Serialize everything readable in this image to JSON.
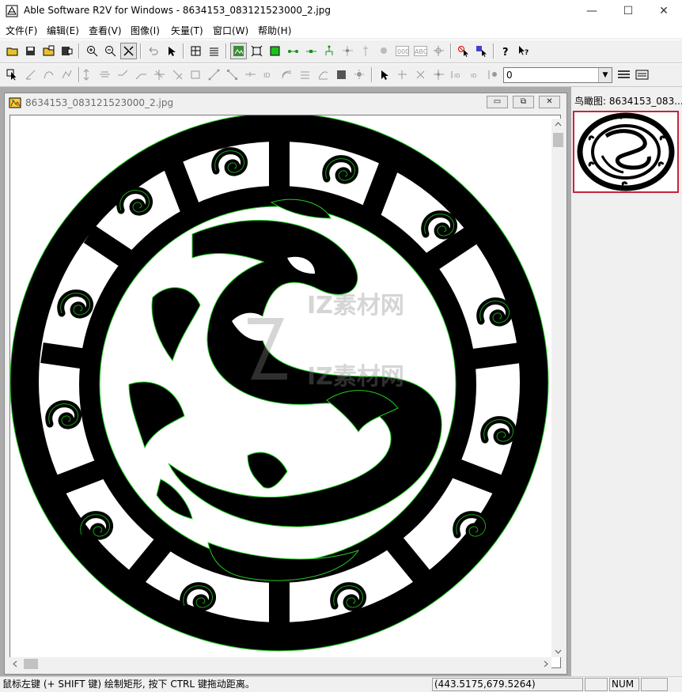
{
  "app": {
    "title": "Able Software R2V for Windows - 8634153_083121523000_2.jpg",
    "window_controls": {
      "minimize": "—",
      "maximize": "☐",
      "close": "✕"
    }
  },
  "menu": [
    "文件(F)",
    "编辑(E)",
    "查看(V)",
    "图像(I)",
    "矢量(T)",
    "窗口(W)",
    "帮助(H)"
  ],
  "toolbar1": {
    "buttons": [
      {
        "icon": "open-icon"
      },
      {
        "icon": "save-icon"
      },
      {
        "icon": "open-image-icon"
      },
      {
        "icon": "save-image-icon"
      },
      {
        "icon": "zoom-in-icon"
      },
      {
        "icon": "zoom-out-icon"
      },
      {
        "icon": "auto-trace-icon",
        "pressed": true
      },
      {
        "icon": "undo-icon"
      },
      {
        "icon": "select-arrow-icon"
      },
      {
        "icon": "layer-grid-icon"
      },
      {
        "icon": "layer-stack-icon"
      },
      {
        "icon": "image-view-icon"
      },
      {
        "icon": "fit-window-icon"
      },
      {
        "icon": "green-square-icon"
      },
      {
        "icon": "node-line-icon"
      },
      {
        "icon": "node-line-2-icon"
      },
      {
        "icon": "node-tree-icon"
      },
      {
        "icon": "point-icon"
      },
      {
        "icon": "pin-icon"
      },
      {
        "icon": "circle-dot-icon"
      },
      {
        "icon": "text-000-icon"
      },
      {
        "icon": "text-abc-icon"
      },
      {
        "icon": "crosshair-icon"
      },
      {
        "icon": "stop-select-icon"
      },
      {
        "icon": "select-color-icon"
      },
      {
        "icon": "help-icon"
      },
      {
        "icon": "context-help-icon"
      }
    ]
  },
  "toolbar2": {
    "buttons": [
      {
        "icon": "edit-pointer-icon"
      },
      {
        "icon": "draw-line-icon"
      },
      {
        "icon": "draw-curve-icon"
      },
      {
        "icon": "draw-poly-icon"
      },
      {
        "icon": "vertical-align-icon"
      },
      {
        "icon": "horizontal-align-icon"
      },
      {
        "icon": "join-icon"
      },
      {
        "icon": "join-2-icon"
      },
      {
        "icon": "node-move-icon"
      },
      {
        "icon": "node-delete-icon"
      },
      {
        "icon": "rect-icon"
      },
      {
        "icon": "line-ends-icon"
      },
      {
        "icon": "diagonal-icon"
      },
      {
        "icon": "split-icon"
      },
      {
        "icon": "id-icon"
      },
      {
        "icon": "contour-icon"
      },
      {
        "icon": "contour-2-icon"
      },
      {
        "icon": "fill-rect-icon"
      },
      {
        "icon": "light-icon"
      },
      {
        "icon": "arrow-select-icon"
      },
      {
        "icon": "add-node-icon"
      },
      {
        "icon": "remove-node-icon"
      },
      {
        "icon": "cross-icon"
      },
      {
        "icon": "label-id-icon"
      },
      {
        "icon": "label-id-2-icon"
      },
      {
        "icon": "light-2-icon"
      }
    ],
    "combo_value": "0",
    "after_buttons": [
      {
        "icon": "layers-icon"
      },
      {
        "icon": "layers-2-icon"
      }
    ]
  },
  "document": {
    "title": "8634153_083121523000_2.jpg",
    "controls": {
      "minimize": "▭",
      "restore": "⧉",
      "close": "✕"
    },
    "watermarks": [
      "IZ素材网",
      "IZ素材网"
    ]
  },
  "birdseye": {
    "title": "鸟瞰图: 8634153_083..."
  },
  "status": {
    "hint": "鼠标左键 (+ SHIFT 键) 绘制矩形, 按下 CTRL 键拖动距离。",
    "coords": "(443.5175,679.5264)",
    "blank": "",
    "num": "NUM"
  },
  "colors": {
    "trace_green": "#22cc22",
    "birdseye_border": "#c8233b"
  }
}
